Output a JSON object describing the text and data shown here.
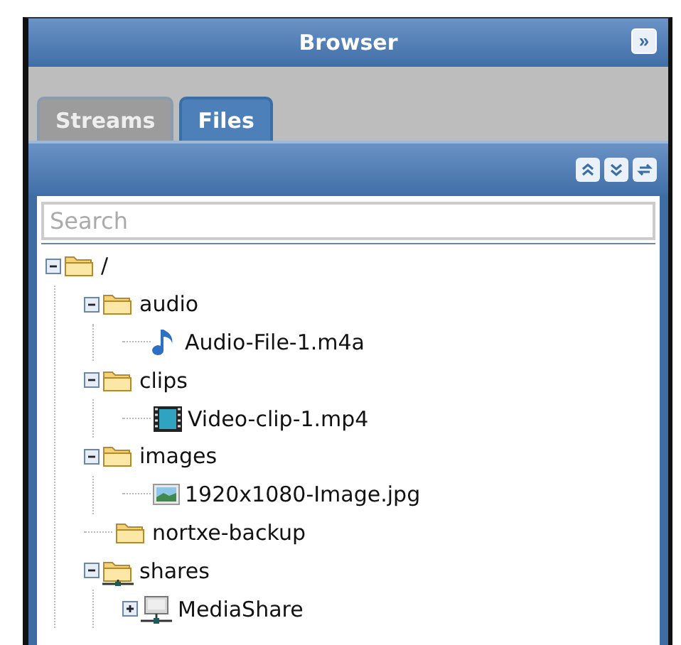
{
  "panel": {
    "title": "Browser",
    "collapse_button": "»"
  },
  "tabs": [
    {
      "label": "Streams",
      "selected": false
    },
    {
      "label": "Files",
      "selected": true
    }
  ],
  "search": {
    "placeholder": "Search"
  },
  "tree": [
    {
      "label": "/",
      "kind": "folder",
      "expanded": true,
      "children": [
        {
          "label": "audio",
          "kind": "folder",
          "expanded": true,
          "children": [
            {
              "label": "Audio-File-1.m4a",
              "kind": "audio"
            }
          ]
        },
        {
          "label": "clips",
          "kind": "folder",
          "expanded": true,
          "children": [
            {
              "label": "Video-clip-1.mp4",
              "kind": "video"
            }
          ]
        },
        {
          "label": "images",
          "kind": "folder",
          "expanded": true,
          "children": [
            {
              "label": "1920x1080-Image.jpg",
              "kind": "image"
            }
          ]
        },
        {
          "label": "nortxe-backup",
          "kind": "folder"
        },
        {
          "label": "shares",
          "kind": "share",
          "expanded": true,
          "children": [
            {
              "label": "MediaShare",
              "kind": "server",
              "expanded": false
            }
          ]
        }
      ]
    }
  ]
}
